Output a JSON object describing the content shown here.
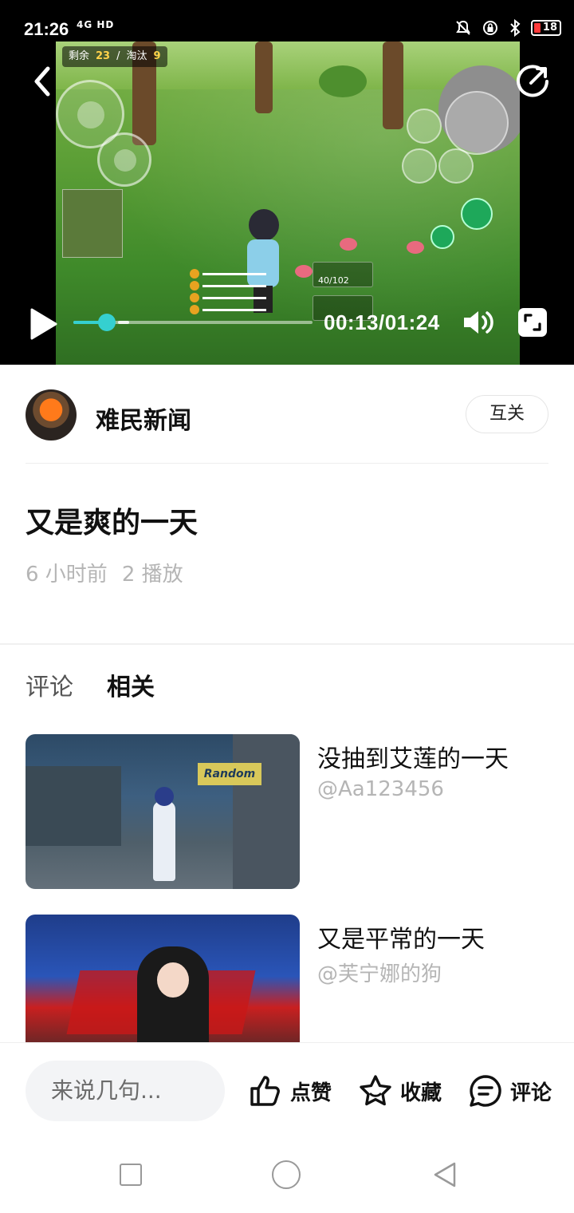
{
  "status_bar": {
    "time": "21:26",
    "signal": "4G HD",
    "battery": "18"
  },
  "video": {
    "hud": {
      "remaining_label": "剩余",
      "remaining_value": "23",
      "eliminated_label": "淘汰",
      "eliminated_value": "9"
    },
    "ammo": "40/102",
    "current_time": "00:13",
    "duration": "01:24",
    "time_display": "00:13/01:24",
    "progress_fraction": 0.14
  },
  "author": {
    "name": "难民新闻",
    "follow_label": "互关"
  },
  "post": {
    "title": "又是爽的一天",
    "time_ago": "6 小时前",
    "plays": "2 播放"
  },
  "tabs": [
    {
      "label": "评论",
      "active": false
    },
    {
      "label": "相关",
      "active": true
    }
  ],
  "related": [
    {
      "title": "没抽到艾莲的一天",
      "author": "@Aa123456",
      "sign": "Random"
    },
    {
      "title": "又是平常的一天",
      "author": "@芙宁娜的狗"
    }
  ],
  "bottom_bar": {
    "comment_placeholder": "来说几句...",
    "like_label": "点赞",
    "favorite_label": "收藏",
    "comment_label": "评论"
  },
  "colors": {
    "accent": "#35d0d0",
    "meta_gray": "#b5b5b5"
  }
}
